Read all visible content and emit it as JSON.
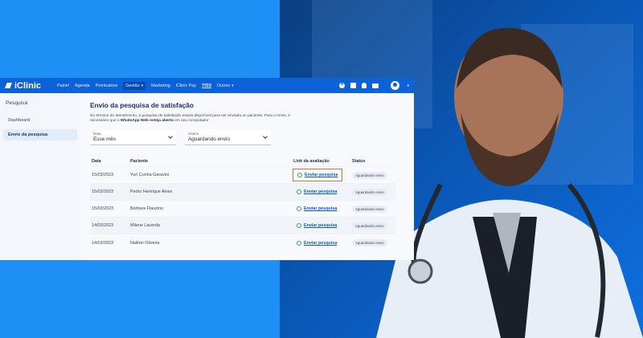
{
  "colors": {
    "background": "#1d8ff5",
    "topbar": "#0b62d9",
    "highlight": "#d07a2a",
    "link": "#0b5ed0",
    "whatsapp": "#3aa357"
  },
  "brand": {
    "name": "iClinic"
  },
  "nav": {
    "items": [
      "Painel",
      "Agenda",
      "Prontuários",
      "Gestão",
      "Marketing",
      "iClinic Pay",
      "TISS",
      "Outros"
    ],
    "active": "Gestão"
  },
  "sidebar": {
    "title": "Pesquisa",
    "items": [
      {
        "label": "Dashboard",
        "selected": false
      },
      {
        "label": "Envio da pesquisa",
        "selected": true
      }
    ]
  },
  "main": {
    "title": "Envio da pesquisa de satisfação",
    "description_prefix": "No término do atendimento, a pesquisa de satisfação estará disponível para ser enviada ao paciente. Para o envio, é necessário que o ",
    "description_bold": "WhatsApp Web esteja aberto",
    "description_suffix": " em seu computador",
    "filters": [
      {
        "label": "Data",
        "value": "Esse mês"
      },
      {
        "label": "Status",
        "value": "Aguardando envio"
      }
    ],
    "columns": [
      "Data",
      "Paciente",
      "Link da avaliação",
      "Status"
    ],
    "rows": [
      {
        "date": "15/03/2023",
        "patient": "Yuri Cunha Garavini",
        "link": "Enviar pesquisa",
        "status": "Aguardando envio"
      },
      {
        "date": "15/03/2023",
        "patient": "Pedro Henrique Alves",
        "link": "Enviar pesquisa",
        "status": "Aguardando envio"
      },
      {
        "date": "15/03/2023",
        "patient": "Bárbara Flauzino",
        "link": "Enviar pesquisa",
        "status": "Aguardando envio"
      },
      {
        "date": "14/03/2023",
        "patient": "Milene Lacerda",
        "link": "Enviar pesquisa",
        "status": "Aguardando envio"
      },
      {
        "date": "14/03/2023",
        "patient": "Nailton Oliveira",
        "link": "Enviar pesquisa",
        "status": "Aguardando envio"
      }
    ]
  }
}
